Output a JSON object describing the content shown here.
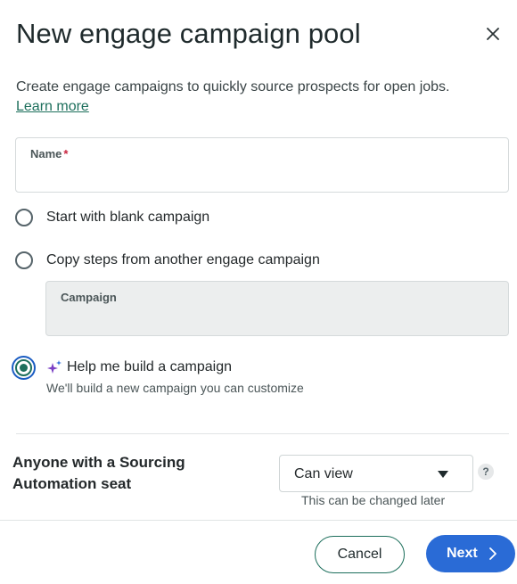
{
  "dialog": {
    "title": "New engage campaign pool",
    "description": "Create engage campaigns to quickly source prospects for open jobs.",
    "learn_more": "Learn more"
  },
  "name_field": {
    "label": "Name",
    "required_mark": "*",
    "value": ""
  },
  "options": {
    "blank": "Start with blank campaign",
    "copy": "Copy steps from another engage campaign",
    "campaign_label": "Campaign",
    "help": "Help me build a campaign",
    "help_sub": "We'll build a new campaign you can customize",
    "selected": "help"
  },
  "permissions": {
    "label": "Anyone with a Sourcing Automation seat",
    "selected": "Can view",
    "hint": "This can be changed later",
    "help_glyph": "?"
  },
  "footer": {
    "cancel": "Cancel",
    "next": "Next"
  },
  "colors": {
    "accent_green": "#1d6f5c",
    "primary_blue": "#2a6bd6",
    "required_red": "#c8233e"
  },
  "icons": [
    "close-icon",
    "sparkle-icon",
    "chevron-down-icon",
    "help-icon",
    "chevron-right-icon"
  ]
}
